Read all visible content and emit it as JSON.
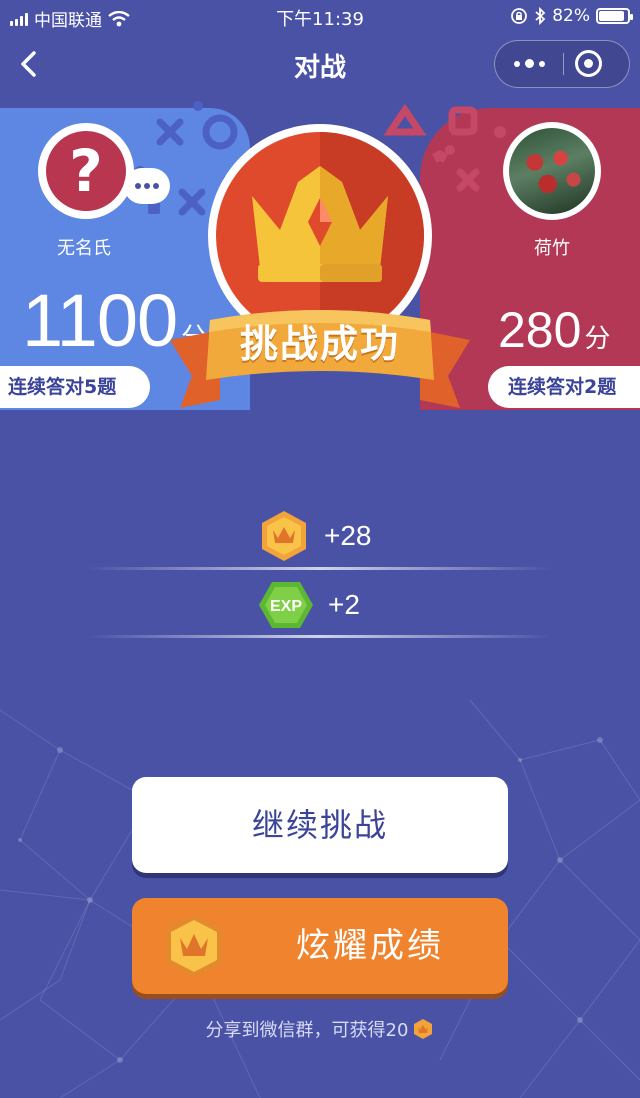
{
  "status_bar": {
    "carrier": "中国联通",
    "time": "下午11:39",
    "battery": "82%",
    "battery_level": 0.82
  },
  "nav": {
    "title": "对战",
    "back_icon": "chevron-left-icon",
    "more_icon": "more-dots-icon",
    "close_icon": "target-close-icon"
  },
  "player_left": {
    "name": "无名氏",
    "score": "1100",
    "score_unit": "分",
    "streak": "连续答对5题",
    "avatar_glyph": "?"
  },
  "player_right": {
    "name": "荷竹",
    "score": "280",
    "score_unit": "分",
    "streak": "连续答对2题"
  },
  "result": {
    "banner": "挑战成功"
  },
  "rewards": {
    "coins": "+28",
    "exp_label": "EXP",
    "exp": "+2"
  },
  "buttons": {
    "continue": "继续挑战",
    "show_off": "炫耀成绩"
  },
  "share_tip": "分享到微信群，可获得20",
  "colors": {
    "background": "#4a52a6",
    "left_panel": "#5d87e2",
    "right_panel": "#b23855",
    "medal": "#e04a2c",
    "button_orange": "#f0832e",
    "ribbon": "#f2a93b"
  }
}
